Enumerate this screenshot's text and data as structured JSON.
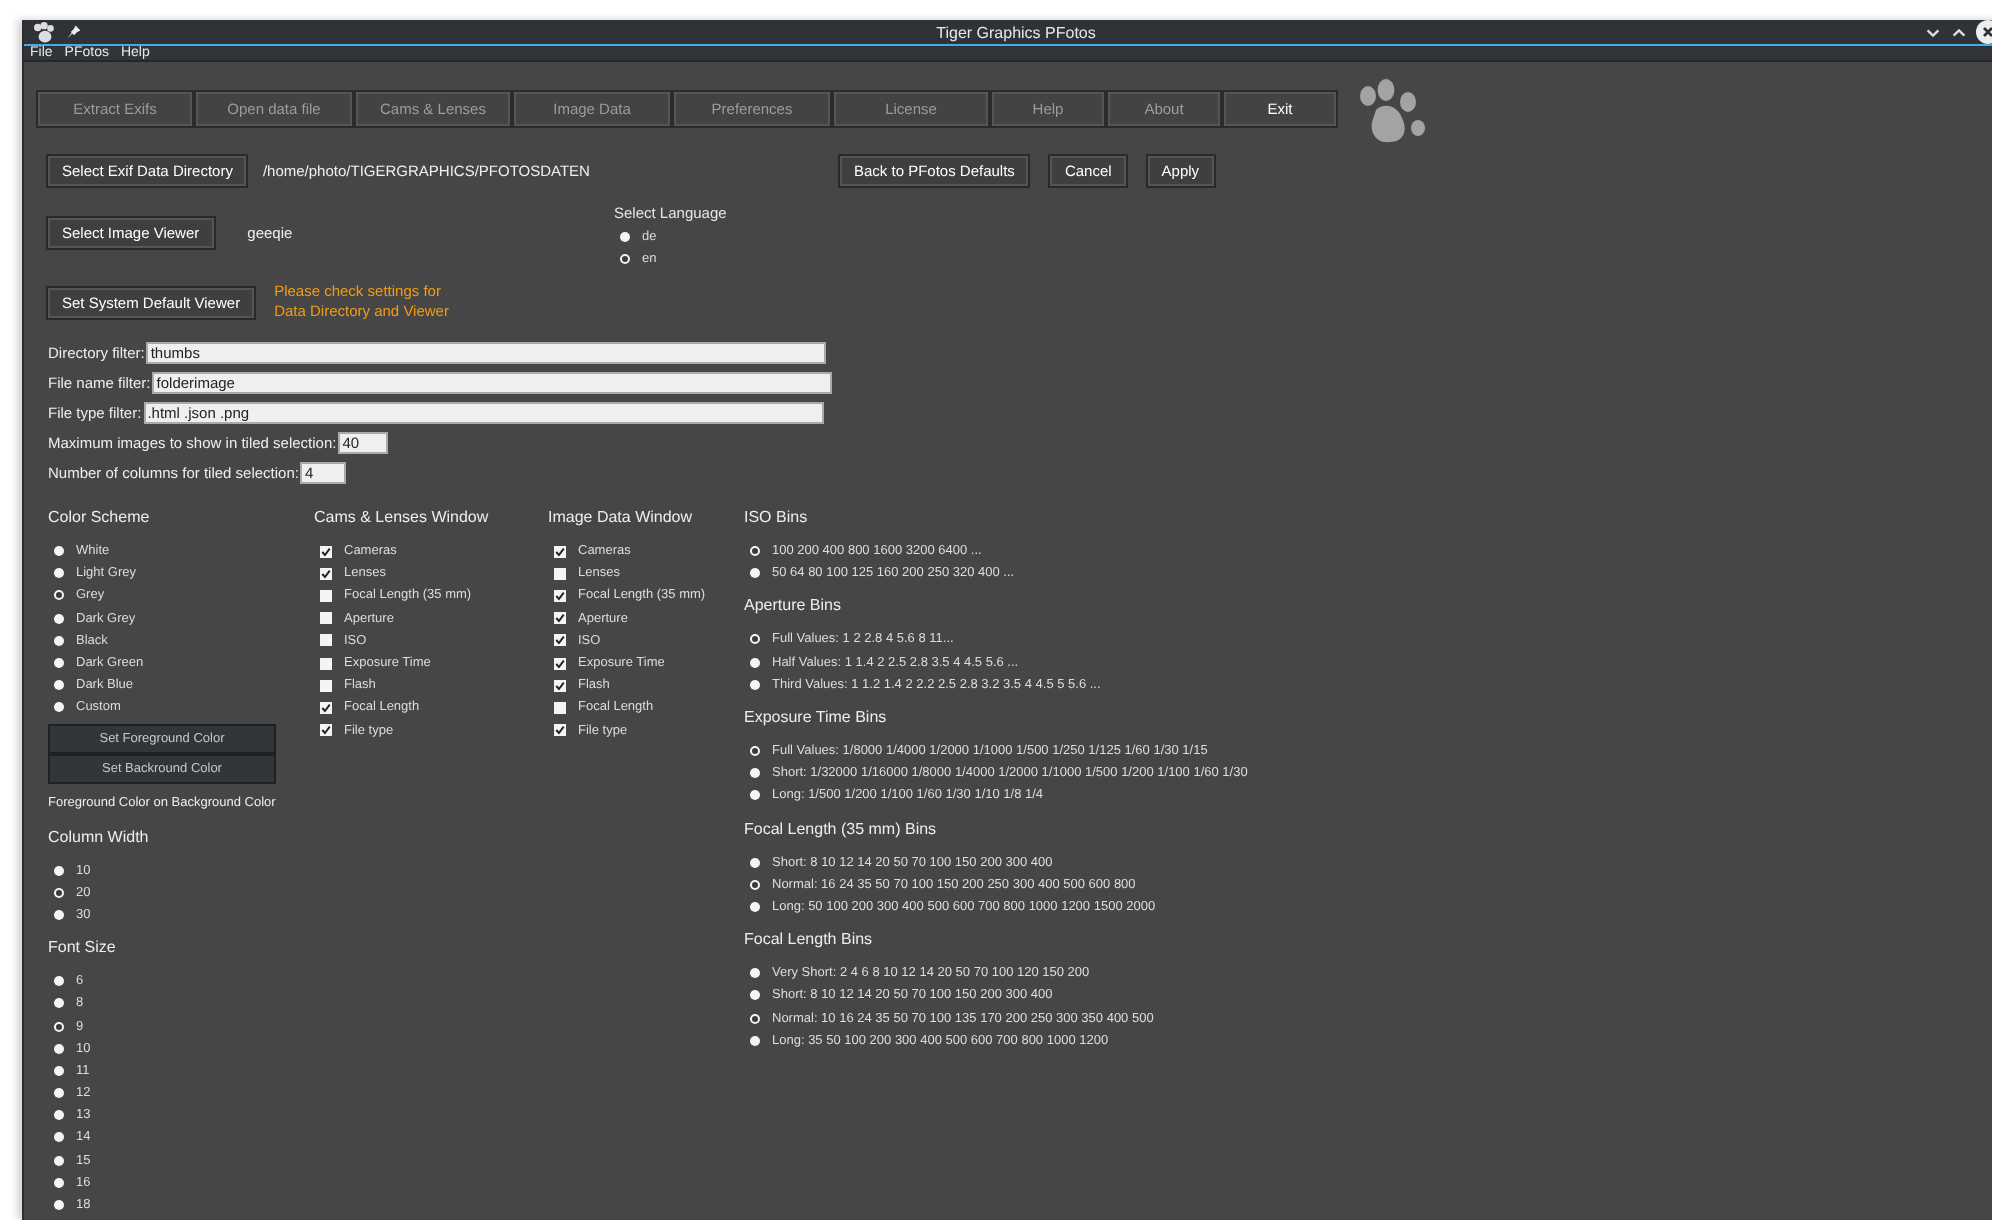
{
  "window": {
    "title": "Tiger Graphics PFotos"
  },
  "menu": [
    "File",
    "PFotos",
    "Help"
  ],
  "tabs": [
    {
      "label": "Extract Exifs",
      "disabled": true
    },
    {
      "label": "Open data file",
      "disabled": true
    },
    {
      "label": "Cams & Lenses",
      "disabled": true
    },
    {
      "label": "Image Data",
      "disabled": true
    },
    {
      "label": "Preferences",
      "disabled": true
    },
    {
      "label": "License",
      "disabled": true
    },
    {
      "label": "Help",
      "disabled": true
    },
    {
      "label": "About",
      "disabled": true
    },
    {
      "label": "Exit",
      "disabled": false
    }
  ],
  "exif_dir": {
    "button": "Select Exif Data Directory",
    "path": "/home/photo/TIGERGRAPHICS/PFOTOSDATEN"
  },
  "actions": [
    "Back to PFotos Defaults",
    "Cancel",
    "Apply"
  ],
  "viewer": {
    "button": "Select Image Viewer",
    "value": "geeqie"
  },
  "system_viewer": {
    "button": "Set System Default Viewer",
    "warning": [
      "Please check settings for",
      "Data Directory and Viewer"
    ]
  },
  "language": {
    "title": "Select Language",
    "options": [
      {
        "label": "de",
        "selected": false
      },
      {
        "label": "en",
        "selected": true
      }
    ]
  },
  "filters": [
    {
      "label": "Directory filter:",
      "value": "thumbs"
    },
    {
      "label": "File name filter:",
      "value": "folderimage"
    },
    {
      "label": "File type filter:",
      "value": ".html .json .png"
    },
    {
      "label": "Maximum images to show in tiled selection:",
      "value": "40"
    },
    {
      "label": "Number of columns for tiled selection:",
      "value": "4"
    }
  ],
  "color_scheme": {
    "title": "Color Scheme",
    "options": [
      {
        "label": "White",
        "selected": false
      },
      {
        "label": "Light Grey",
        "selected": false
      },
      {
        "label": "Grey",
        "selected": true
      },
      {
        "label": "Dark Grey",
        "selected": false
      },
      {
        "label": "Black",
        "selected": false
      },
      {
        "label": "Dark Green",
        "selected": false
      },
      {
        "label": "Dark Blue",
        "selected": false
      },
      {
        "label": "Custom",
        "selected": false
      }
    ],
    "buttons": [
      "Set Foreground Color",
      "Set Backround Color"
    ],
    "preview": "Foreground Color on Background Color"
  },
  "column_width": {
    "title": "Column Width",
    "options": [
      {
        "label": "10",
        "selected": false
      },
      {
        "label": "20",
        "selected": true
      },
      {
        "label": "30",
        "selected": false
      }
    ]
  },
  "font_size": {
    "title": "Font Size",
    "options": [
      {
        "label": "6",
        "selected": false
      },
      {
        "label": "8",
        "selected": false
      },
      {
        "label": "9",
        "selected": true
      },
      {
        "label": "10",
        "selected": false
      },
      {
        "label": "11",
        "selected": false
      },
      {
        "label": "12",
        "selected": false
      },
      {
        "label": "13",
        "selected": false
      },
      {
        "label": "14",
        "selected": false
      },
      {
        "label": "15",
        "selected": false
      },
      {
        "label": "16",
        "selected": false
      },
      {
        "label": "18",
        "selected": false
      }
    ]
  },
  "cams_lenses": {
    "title": "Cams & Lenses Window",
    "items": [
      {
        "label": "Cameras",
        "checked": true
      },
      {
        "label": "Lenses",
        "checked": true
      },
      {
        "label": "Focal Length (35 mm)",
        "checked": false
      },
      {
        "label": "Aperture",
        "checked": false
      },
      {
        "label": "ISO",
        "checked": false
      },
      {
        "label": "Exposure Time",
        "checked": false
      },
      {
        "label": "Flash",
        "checked": false
      },
      {
        "label": "Focal Length",
        "checked": true
      },
      {
        "label": "File type",
        "checked": true
      }
    ]
  },
  "image_data": {
    "title": "Image Data Window",
    "items": [
      {
        "label": "Cameras",
        "checked": true
      },
      {
        "label": "Lenses",
        "checked": false
      },
      {
        "label": "Focal Length (35 mm)",
        "checked": true
      },
      {
        "label": "Aperture",
        "checked": true
      },
      {
        "label": "ISO",
        "checked": true
      },
      {
        "label": "Exposure Time",
        "checked": true
      },
      {
        "label": "Flash",
        "checked": true
      },
      {
        "label": "Focal Length",
        "checked": false
      },
      {
        "label": "File type",
        "checked": true
      }
    ]
  },
  "bins": [
    {
      "title": "ISO Bins",
      "options": [
        {
          "label": "100 200 400 800 1600 3200 6400 ...",
          "selected": true
        },
        {
          "label": "50 64 80 100 125 160 200 250 320 400 ...",
          "selected": false
        }
      ]
    },
    {
      "title": "Aperture Bins",
      "options": [
        {
          "label": "Full Values: 1 2 2.8 4 5.6 8 11...",
          "selected": true
        },
        {
          "label": "Half Values: 1 1.4 2 2.5 2.8 3.5 4 4.5 5.6 ...",
          "selected": false
        },
        {
          "label": "Third Values:  1 1.2 1.4 2 2.2 2.5 2.8 3.2 3.5 4 4.5 5 5.6 ...",
          "selected": false
        }
      ]
    },
    {
      "title": "Exposure Time Bins",
      "options": [
        {
          "label": "Full Values: 1/8000 1/4000 1/2000 1/1000 1/500 1/250 1/125 1/60 1/30 1/15",
          "selected": true
        },
        {
          "label": "Short: 1/32000 1/16000 1/8000 1/4000 1/2000 1/1000 1/500 1/200 1/100 1/60 1/30",
          "selected": false
        },
        {
          "label": "Long:  1/500 1/200 1/100 1/60 1/30 1/10 1/8 1/4",
          "selected": false
        }
      ]
    },
    {
      "title": "Focal Length (35 mm) Bins",
      "options": [
        {
          "label": "Short: 8 10 12 14 20 50 70 100 150 200 300 400",
          "selected": false
        },
        {
          "label": "Normal: 16 24 35 50 70 100 150 200 250 300 400 500 600 800",
          "selected": true
        },
        {
          "label": "Long: 50 100 200 300 400 500 600 700 800 1000 1200 1500 2000",
          "selected": false
        }
      ]
    },
    {
      "title": "Focal Length Bins",
      "options": [
        {
          "label": "Very Short: 2 4 6 8 10 12 14 20 50 70 100 120 150 200",
          "selected": false
        },
        {
          "label": "Short: 8 10 12 14 20 50 70 100 150 200 300 400",
          "selected": false
        },
        {
          "label": "Normal: 10 16 24 35 50 70 100 135 170 200 250 300 350 400 500",
          "selected": true
        },
        {
          "label": "Long: 35 50 100 200 300 400 500 600 700 800 1000 1200",
          "selected": false
        }
      ]
    }
  ]
}
